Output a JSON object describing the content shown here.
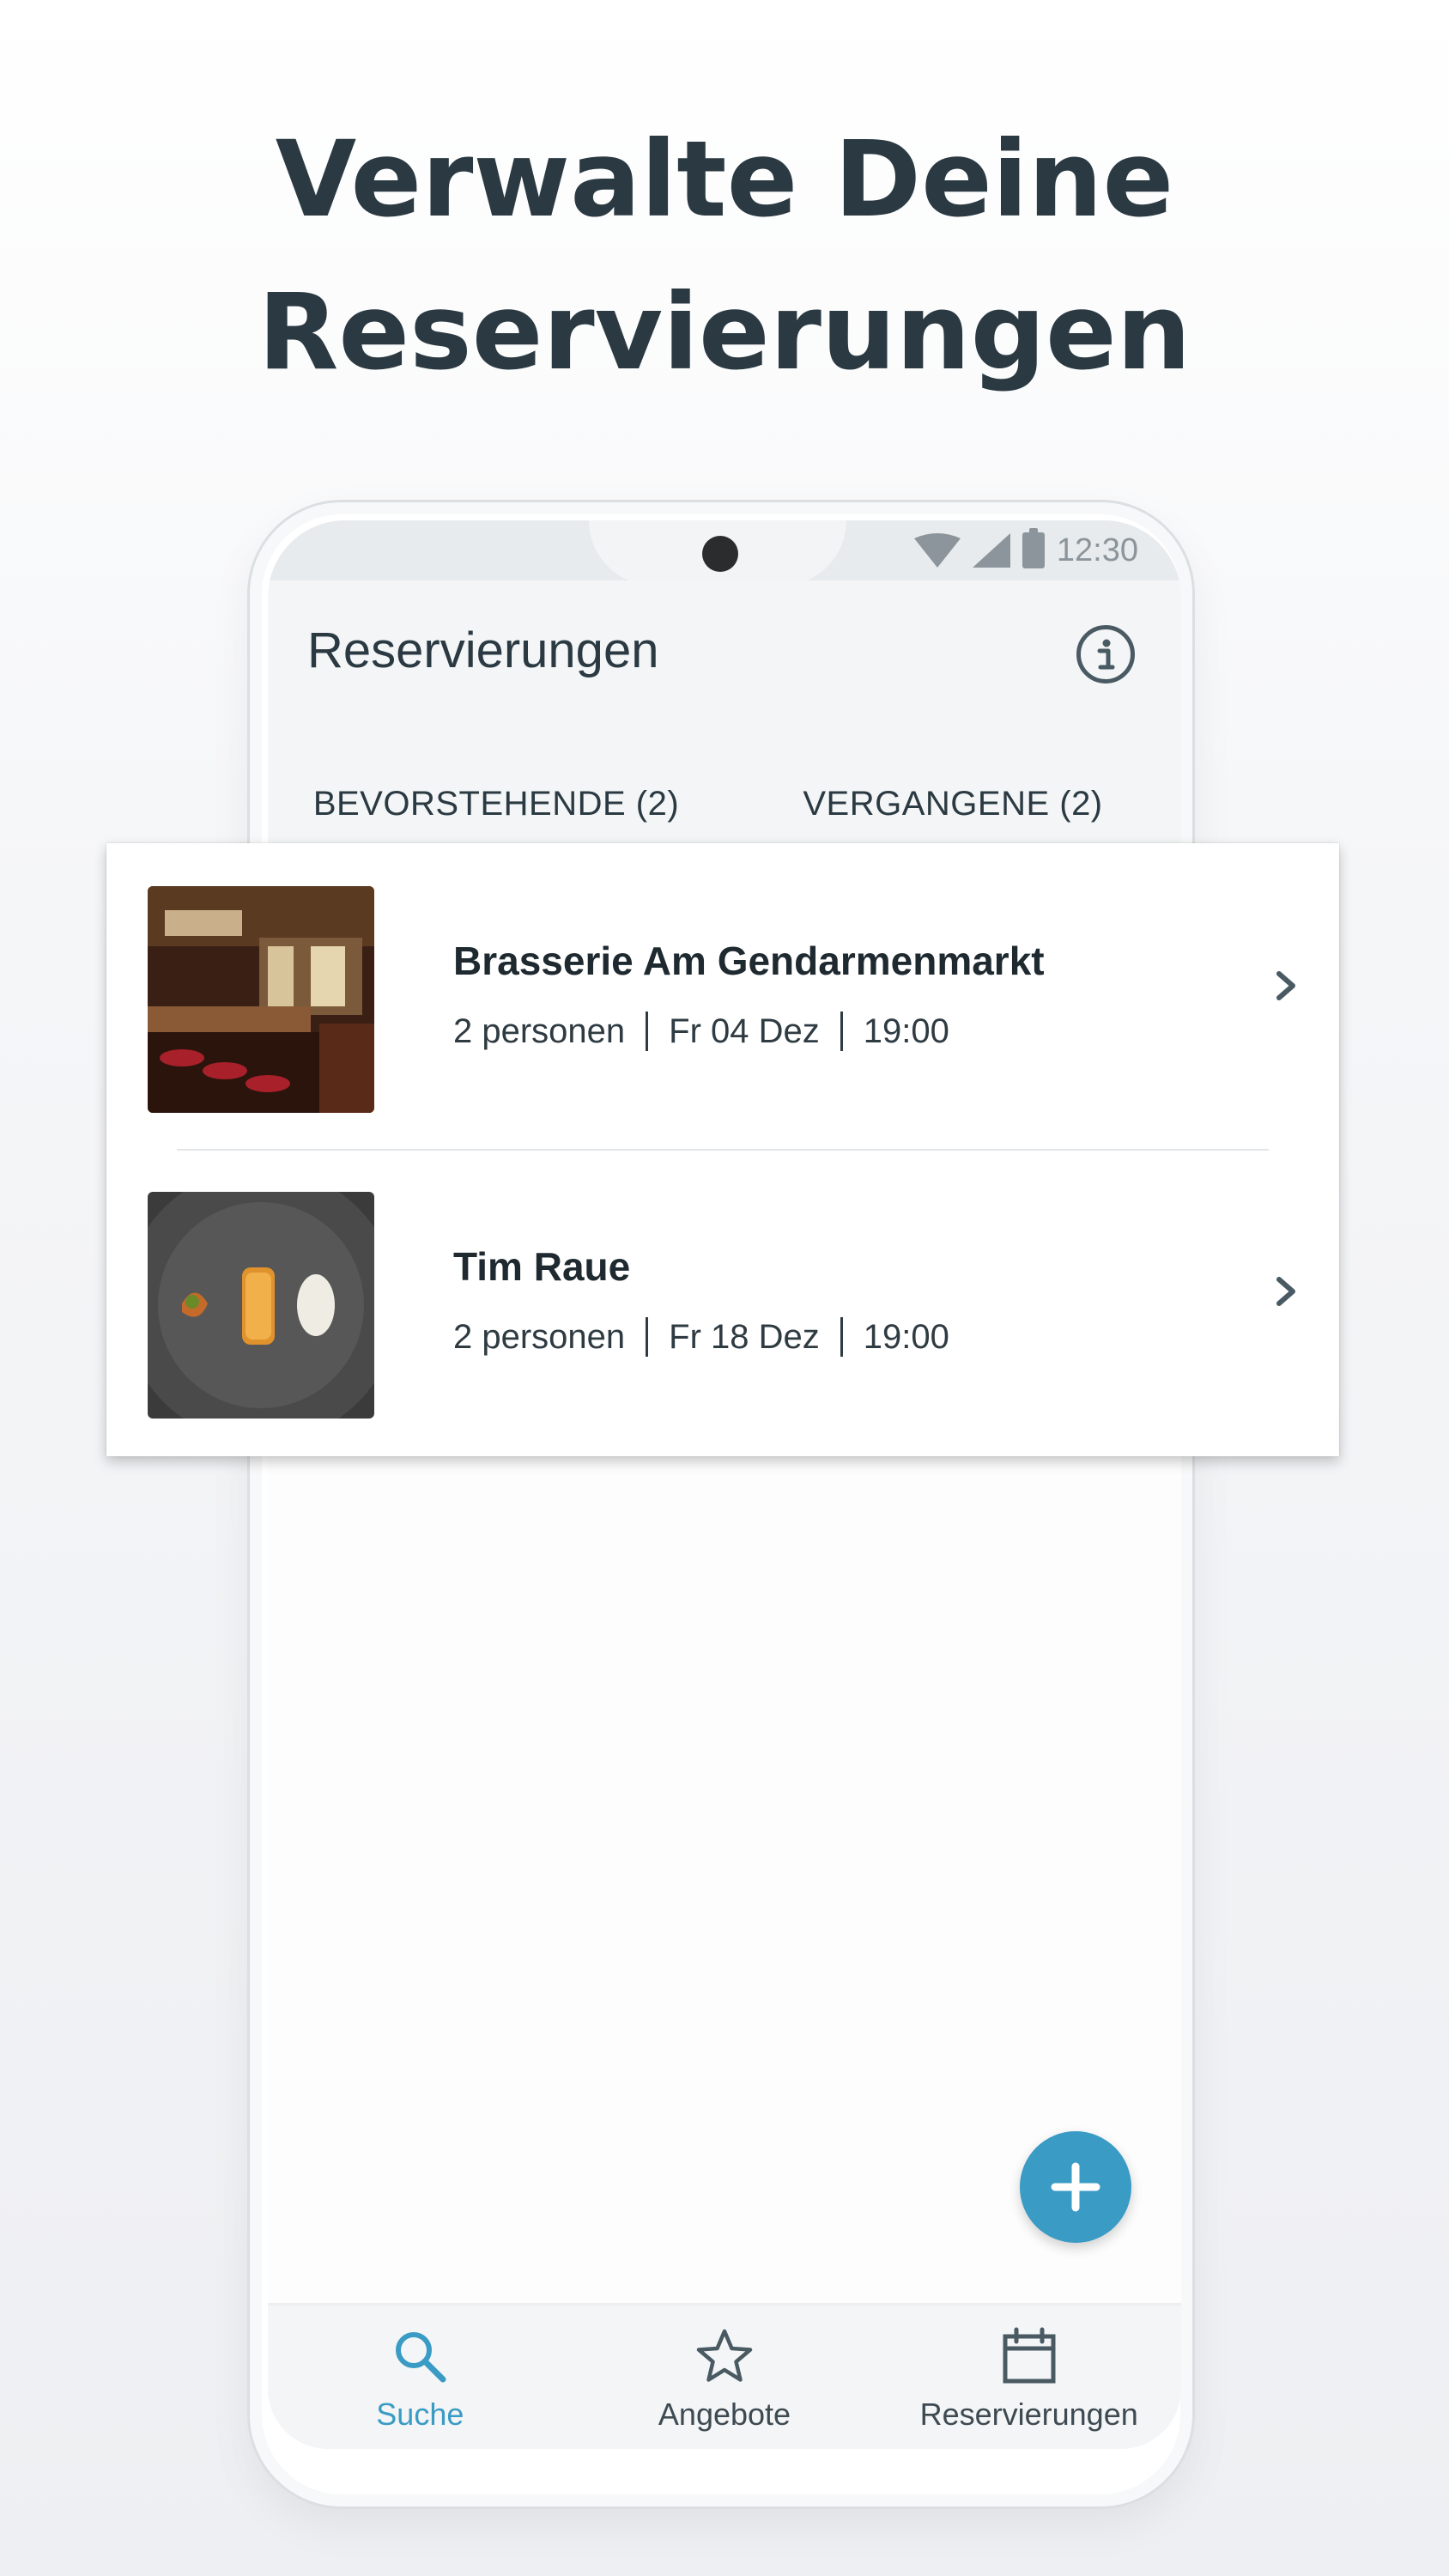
{
  "headline": {
    "line1": "Verwalte Deine",
    "line2": "Reservierungen"
  },
  "status_bar": {
    "time": "12:30"
  },
  "app_bar": {
    "title": "Reservierungen"
  },
  "tabs": [
    {
      "label": "BEVORSTEHENDE (2)",
      "active": true
    },
    {
      "label": "VERGANGENE (2)",
      "active": false
    }
  ],
  "reservations": [
    {
      "name": "Brasserie Am Gendarmenmarkt",
      "persons": "2 personen",
      "date": "Fr 04 Dez",
      "time": "19:00"
    },
    {
      "name": "Tim Raue",
      "persons": "2 personen",
      "date": "Fr 18 Dez",
      "time": "19:00"
    }
  ],
  "bottom_nav": [
    {
      "label": "Suche",
      "icon": "search-icon",
      "active": true
    },
    {
      "label": "Angebote",
      "icon": "star-icon",
      "active": false
    },
    {
      "label": "Reservierungen",
      "icon": "calendar-icon",
      "active": false
    }
  ],
  "colors": {
    "accent": "#3a9bc5",
    "tab_indicator": "#2f8fb0",
    "text": "#2b3a42"
  }
}
